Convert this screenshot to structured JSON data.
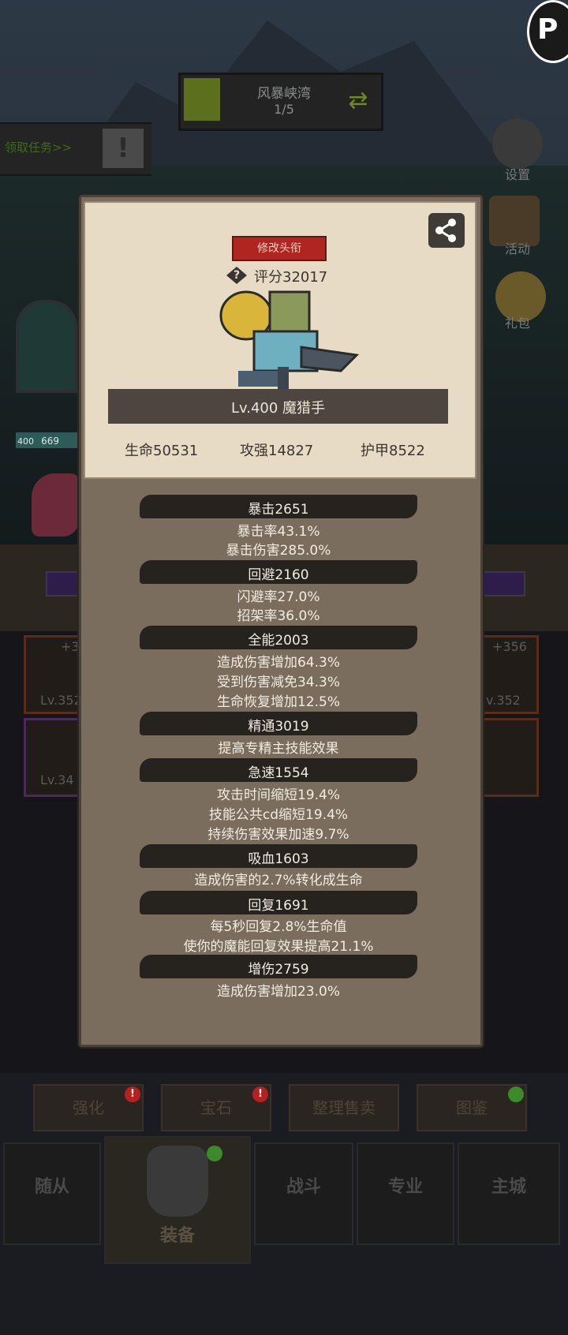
{
  "map": {
    "name": "风暴峡湾",
    "progress": "1/5"
  },
  "task": {
    "label": "领取任务>>"
  },
  "side_menu": {
    "settings": "设置",
    "activity": "活动",
    "gift": "礼包"
  },
  "background_slots": {
    "left_top_level": "+3",
    "left_top_lv": "Lv.352",
    "left_bottom_lv": "Lv.34",
    "right_top_level": "+356",
    "right_top_lv": "v.352",
    "hero_level_badge": "400",
    "hero_hp": "669"
  },
  "modal": {
    "edit_title_button": "修改头衔",
    "score": "评分32017",
    "hero_name": "Lv.400 魔猎手",
    "main_stats": [
      "生命50531",
      "攻强14827",
      "护甲8522"
    ],
    "stats": [
      {
        "title": "暴击2651",
        "details": [
          "暴击率43.1%",
          "暴击伤害285.0%"
        ]
      },
      {
        "title": "回避2160",
        "details": [
          "闪避率27.0%",
          "招架率36.0%"
        ]
      },
      {
        "title": "全能2003",
        "details": [
          "造成伤害增加64.3%",
          "受到伤害减免34.3%",
          "生命恢复增加12.5%"
        ]
      },
      {
        "title": "精通3019",
        "details": [
          "提高专精主技能效果"
        ]
      },
      {
        "title": "急速1554",
        "details": [
          "攻击时间缩短19.4%",
          "技能公共cd缩短19.4%",
          "持续伤害效果加速9.7%"
        ]
      },
      {
        "title": "吸血1603",
        "details": [
          "造成伤害的2.7%转化成生命"
        ]
      },
      {
        "title": "回复1691",
        "details": [
          "每5秒回复2.8%生命值",
          "使你的魔能回复效果提高21.1%"
        ]
      },
      {
        "title": "增伤2759",
        "details": [
          "造成伤害增加23.0%"
        ]
      }
    ]
  },
  "action_buttons": [
    "强化",
    "宝石",
    "整理售卖",
    "图鉴"
  ],
  "nav": [
    "随从",
    "装备",
    "战斗",
    "专业",
    "主城"
  ],
  "colors": {
    "modal_bg": "#7a6d5d",
    "parchment": "#e8dbc6",
    "title_red": "#b0251f",
    "stat_banner": "#26221e"
  }
}
